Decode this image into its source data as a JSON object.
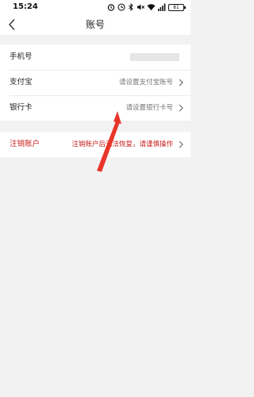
{
  "status_bar": {
    "time": "15:24",
    "battery": "81"
  },
  "nav": {
    "title": "账号"
  },
  "rows": {
    "phone": {
      "label": "手机号",
      "value": ""
    },
    "alipay": {
      "label": "支付宝",
      "value": "请设置支付宝账号"
    },
    "bank_card": {
      "label": "银行卡",
      "value": "请设置银行卡号"
    }
  },
  "cancel_account": {
    "label": "注销账户",
    "hint": "注销账户后无法恢复，请谨慎操作"
  },
  "colors": {
    "danger": "#c81d1d",
    "annotation_arrow": "#e8352a",
    "background": "#f2f2f2"
  }
}
